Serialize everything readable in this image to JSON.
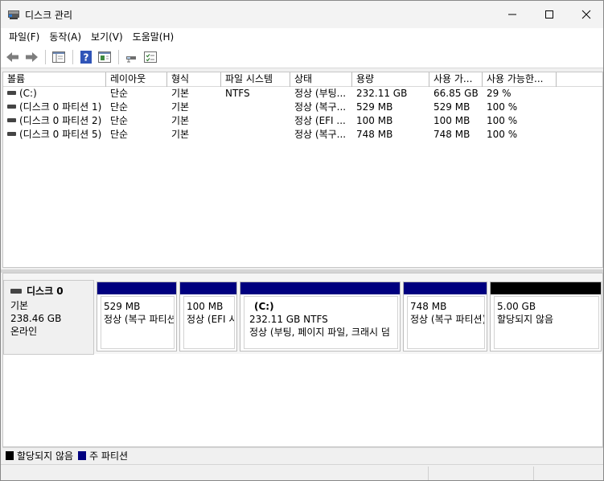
{
  "window": {
    "title": "디스크 관리"
  },
  "menu": {
    "items": [
      "파일(F)",
      "동작(A)",
      "보기(V)",
      "도움말(H)"
    ]
  },
  "toolbar": {
    "icons": [
      "back-arrow-icon",
      "forward-arrow-icon",
      "console-tree-icon",
      "help-icon",
      "properties-icon",
      "connect-icon",
      "list-icon"
    ]
  },
  "volumes": {
    "columns": [
      "볼륨",
      "레이아웃",
      "형식",
      "파일 시스템",
      "상태",
      "용량",
      "사용 가...",
      "사용 가능한..."
    ],
    "rows": [
      [
        "(C:)",
        "단순",
        "기본",
        "NTFS",
        "정상 (부팅...",
        "232.11 GB",
        "66.85 GB",
        "29 %"
      ],
      [
        "(디스크 0 파티션 1)",
        "단순",
        "기본",
        "",
        "정상 (복구...",
        "529 MB",
        "529 MB",
        "100 %"
      ],
      [
        "(디스크 0 파티션 2)",
        "단순",
        "기본",
        "",
        "정상 (EFI ...",
        "100 MB",
        "100 MB",
        "100 %"
      ],
      [
        "(디스크 0 파티션 5)",
        "단순",
        "기본",
        "",
        "정상 (복구...",
        "748 MB",
        "748 MB",
        "100 %"
      ]
    ]
  },
  "disk": {
    "name": "디스크 0",
    "type": "기본",
    "size": "238.46 GB",
    "status": "온라인",
    "partitions": [
      {
        "label": "",
        "size": "529 MB",
        "status": "정상 (복구 파티션)",
        "kind": "primary"
      },
      {
        "label": "",
        "size": "100 MB",
        "status": "정상 (EFI 시",
        "kind": "primary"
      },
      {
        "label": "(C:)",
        "size": "232.11 GB NTFS",
        "status": "정상 (부팅, 페이지 파일, 크래시 덤",
        "kind": "primary"
      },
      {
        "label": "",
        "size": "748 MB",
        "status": "정상 (복구 파티션)",
        "kind": "primary"
      },
      {
        "label": "",
        "size": "5.00 GB",
        "status": "할당되지 않음",
        "kind": "unallocated"
      }
    ]
  },
  "legend": {
    "unallocated": "할당되지 않음",
    "primary": "주 파티션",
    "colors": {
      "unallocated": "#000000",
      "primary": "#00007f"
    }
  }
}
